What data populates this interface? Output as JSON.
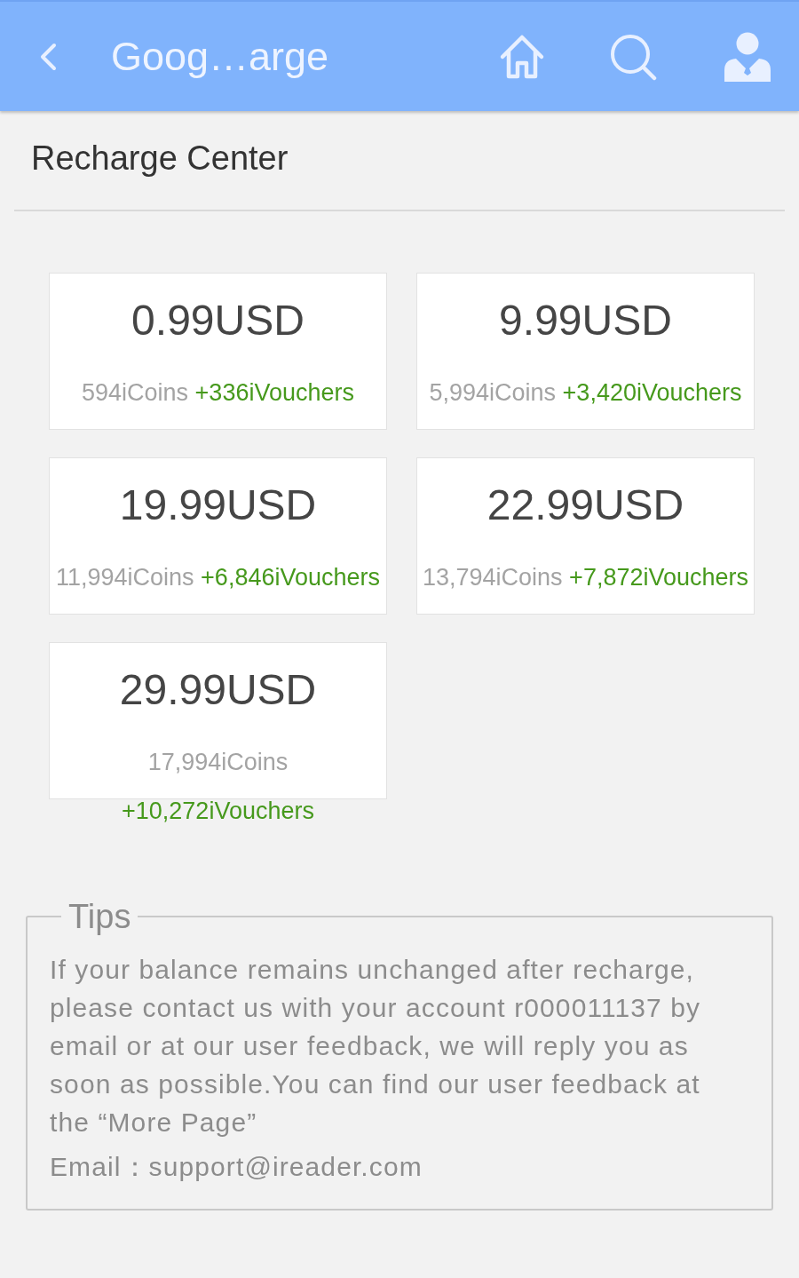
{
  "header": {
    "title": "Goog…arge"
  },
  "page_title": "Recharge Center",
  "packages": [
    {
      "price": "0.99USD",
      "coins": "594iCoins",
      "vouchers": "+336iVouchers"
    },
    {
      "price": "9.99USD",
      "coins": "5,994iCoins",
      "vouchers": "+3,420iVouchers"
    },
    {
      "price": "19.99USD",
      "coins": "11,994iCoins",
      "vouchers": "+6,846iVouchers"
    },
    {
      "price": "22.99USD",
      "coins": "13,794iCoins",
      "vouchers": "+7,872iVouchers"
    },
    {
      "price": "29.99USD",
      "coins": "17,994iCoins",
      "vouchers": "+10,272iVouchers"
    }
  ],
  "tips": {
    "title": "Tips",
    "text": "If your balance remains unchanged after recharge, please contact us with your account r000011137 by email or at our user feedback, we will reply you as soon as possible.You can find our user feedback at the “More Page”",
    "email": "Email：support@ireader.com"
  }
}
